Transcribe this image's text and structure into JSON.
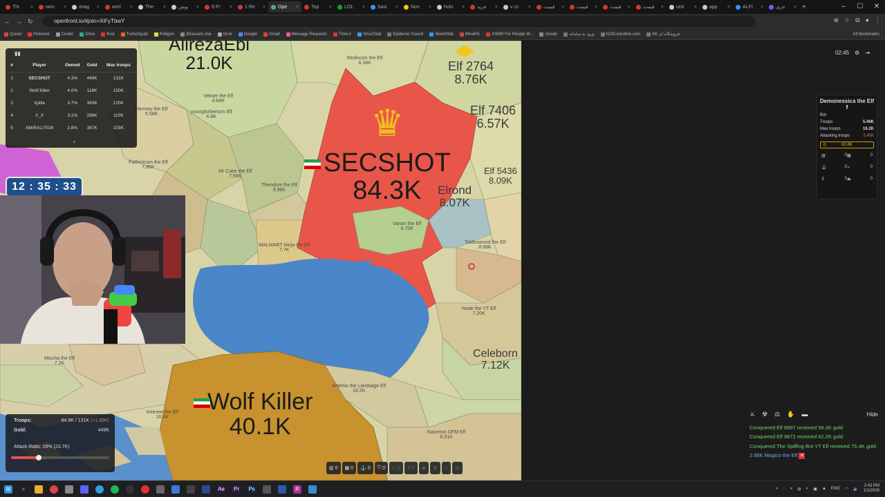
{
  "browser": {
    "tabs": [
      {
        "label": "Thi",
        "color": "#d33"
      },
      {
        "label": "won",
        "color": "#d33"
      },
      {
        "label": "imag",
        "color": "#ccc"
      },
      {
        "label": "worl",
        "color": "#d33"
      },
      {
        "label": "The",
        "color": "#ccc"
      },
      {
        "label": "پوش",
        "color": "#ccc"
      },
      {
        "label": "8 Fr",
        "color": "#d33"
      },
      {
        "label": "1 Re",
        "color": "#d33"
      },
      {
        "label": "Ope",
        "color": "#5a8"
      },
      {
        "label": "Top",
        "color": "#d33"
      },
      {
        "label": "LOL",
        "color": "#1a1"
      },
      {
        "label": "Savi",
        "color": "#39f"
      },
      {
        "label": "Non",
        "color": "#fc0"
      },
      {
        "label": "holo",
        "color": "#ccc"
      },
      {
        "label": "خرید",
        "color": "#d33"
      },
      {
        "label": "v cc",
        "color": "#ccc"
      },
      {
        "label": "قیمت",
        "color": "#d33"
      },
      {
        "label": "قیمت",
        "color": "#d33"
      },
      {
        "label": "قیمت",
        "color": "#d33"
      },
      {
        "label": "قیمت",
        "color": "#d33"
      },
      {
        "label": "unti",
        "color": "#ccc"
      },
      {
        "label": "app",
        "color": "#ccc"
      },
      {
        "label": "ALFI",
        "color": "#39f"
      },
      {
        "label": "خری",
        "color": "#66f"
      }
    ],
    "active_tab": 8,
    "url": "openfront.io/#join=XiFyTbwY",
    "bookmarks": [
      "Quixel",
      "Pinterest",
      "Cooler",
      "Drive",
      "Kick",
      "TurboSquid",
      "Poliigon",
      "3Dassets.one",
      "Grok",
      "Google",
      "Gmail",
      "Message Requests",
      "Time.ir",
      "VirusTotal",
      "Epidemic Sound",
      "Sketchfab",
      "MinePic",
      "ASMR For People W...",
      "Goods",
      "ورود به سامانه",
      "h230.irandmx.com",
      "فروشگاه ای کالا"
    ],
    "all_bookmarks": "All Bookmarks"
  },
  "leaderboard": {
    "headers": [
      "#",
      "Player",
      "Owned",
      "Gold",
      "Max troops"
    ],
    "rows": [
      [
        "1",
        "SECSHOT",
        "4.3%",
        "448K",
        "131K"
      ],
      [
        "2",
        "Wolf Killer",
        "4.0%",
        "118K",
        "150K"
      ],
      [
        "3",
        "Xplite",
        "3.7%",
        "383K",
        "120K"
      ],
      [
        "4",
        "X_X",
        "3.1%",
        "286K",
        "110K"
      ],
      [
        "5",
        "AMIRALI7028",
        "2.8%",
        "387K",
        "103K"
      ]
    ],
    "expand": "+"
  },
  "timer": "12 : 35 : 33",
  "map": {
    "big_labels": [
      {
        "name": "AlirezaEbi",
        "value": "21.0K"
      },
      {
        "name": "SECSHOT",
        "value": "84.3K"
      },
      {
        "name": "Wolf Killer",
        "value": "40.1K"
      }
    ],
    "medium_labels": [
      {
        "name": "Elf 2764",
        "value": "8.76K"
      },
      {
        "name": "Elf 7406",
        "value": "6.57K"
      },
      {
        "name": "Elf 5436",
        "value": "8.09K"
      },
      {
        "name": "Elrond",
        "value": "8.07K"
      },
      {
        "name": "Celeborn",
        "value": "7.12K"
      }
    ],
    "small_labels": [
      {
        "name": "Redincon the Elf",
        "value": "6.34K"
      },
      {
        "name": "Vekser the Elf",
        "value": "4.84K"
      },
      {
        "name": "Hermey the Elf",
        "value": "5.58K"
      },
      {
        "name": "Mr Cube the Elf",
        "value": "7.56K"
      },
      {
        "name": "Theodore the Elf",
        "value": "9.98K"
      },
      {
        "name": "Vanon the Elf",
        "value": "6.70K"
      },
      {
        "name": "WALMART Ninja the Elf",
        "value": "7.7K"
      },
      {
        "name": "Toldinsound the Elf",
        "value": "8.68K"
      },
      {
        "name": "Node the YT Elf",
        "value": "7.20K"
      },
      {
        "name": "Mischa the Elf",
        "value": "7.2K"
      },
      {
        "name": "Keevee the Elf",
        "value": "16.4K"
      },
      {
        "name": "Kaizeron OFM Elf",
        "value": "6.91K"
      },
      {
        "name": "Artemis the Landsage Elf",
        "value": "16.2K"
      },
      {
        "name": "youngforberturn Elf",
        "value": "6.8K"
      },
      {
        "name": "Pathickrum the Elf",
        "value": "7.86K"
      }
    ]
  },
  "stats": {
    "troops_label": "Troops:",
    "troops_value": "84.9K / 131K",
    "troops_delta": "(+1.89K)",
    "gold_label": "Gold:",
    "gold_value": "449K",
    "attack_ratio": "Attack Ratio: 28% (23.7K)",
    "attack_ratio_fraction": 0.28
  },
  "toolbar": [
    "0",
    "0",
    "0",
    "0",
    "0",
    "0"
  ],
  "hud": {
    "clock": "02:45"
  },
  "player_panel": {
    "name": "Demonessica the Elf",
    "flag": "f",
    "type": "Bot",
    "troops_label": "Troops",
    "troops": "5.46K",
    "max_label": "Max troops",
    "max": "16.2K",
    "attacking_label": "Attacking troops",
    "attacking": "3.45K",
    "gold": "82.8K",
    "units": [
      "0",
      "0",
      "0",
      "0",
      "0",
      "0"
    ]
  },
  "events": {
    "hide": "Hide",
    "items": [
      "Conquered Elf 8897 received 58.3K gold",
      "Conquered Elf 9672 received 62.2K gold",
      "Conquered The Spiffing Brit YT Elf received 75.4K gold"
    ],
    "incoming": "2.88K Magico the Elf"
  },
  "taskbar": {
    "lang": "ENG",
    "time": "2:43 PM",
    "date": "1/1/2026"
  },
  "colors": {
    "secshot": "#e8564a",
    "wolf": "#c8922e",
    "sea": "#4a86c8",
    "panel": "#161616",
    "event_green": "#6fd46f"
  }
}
